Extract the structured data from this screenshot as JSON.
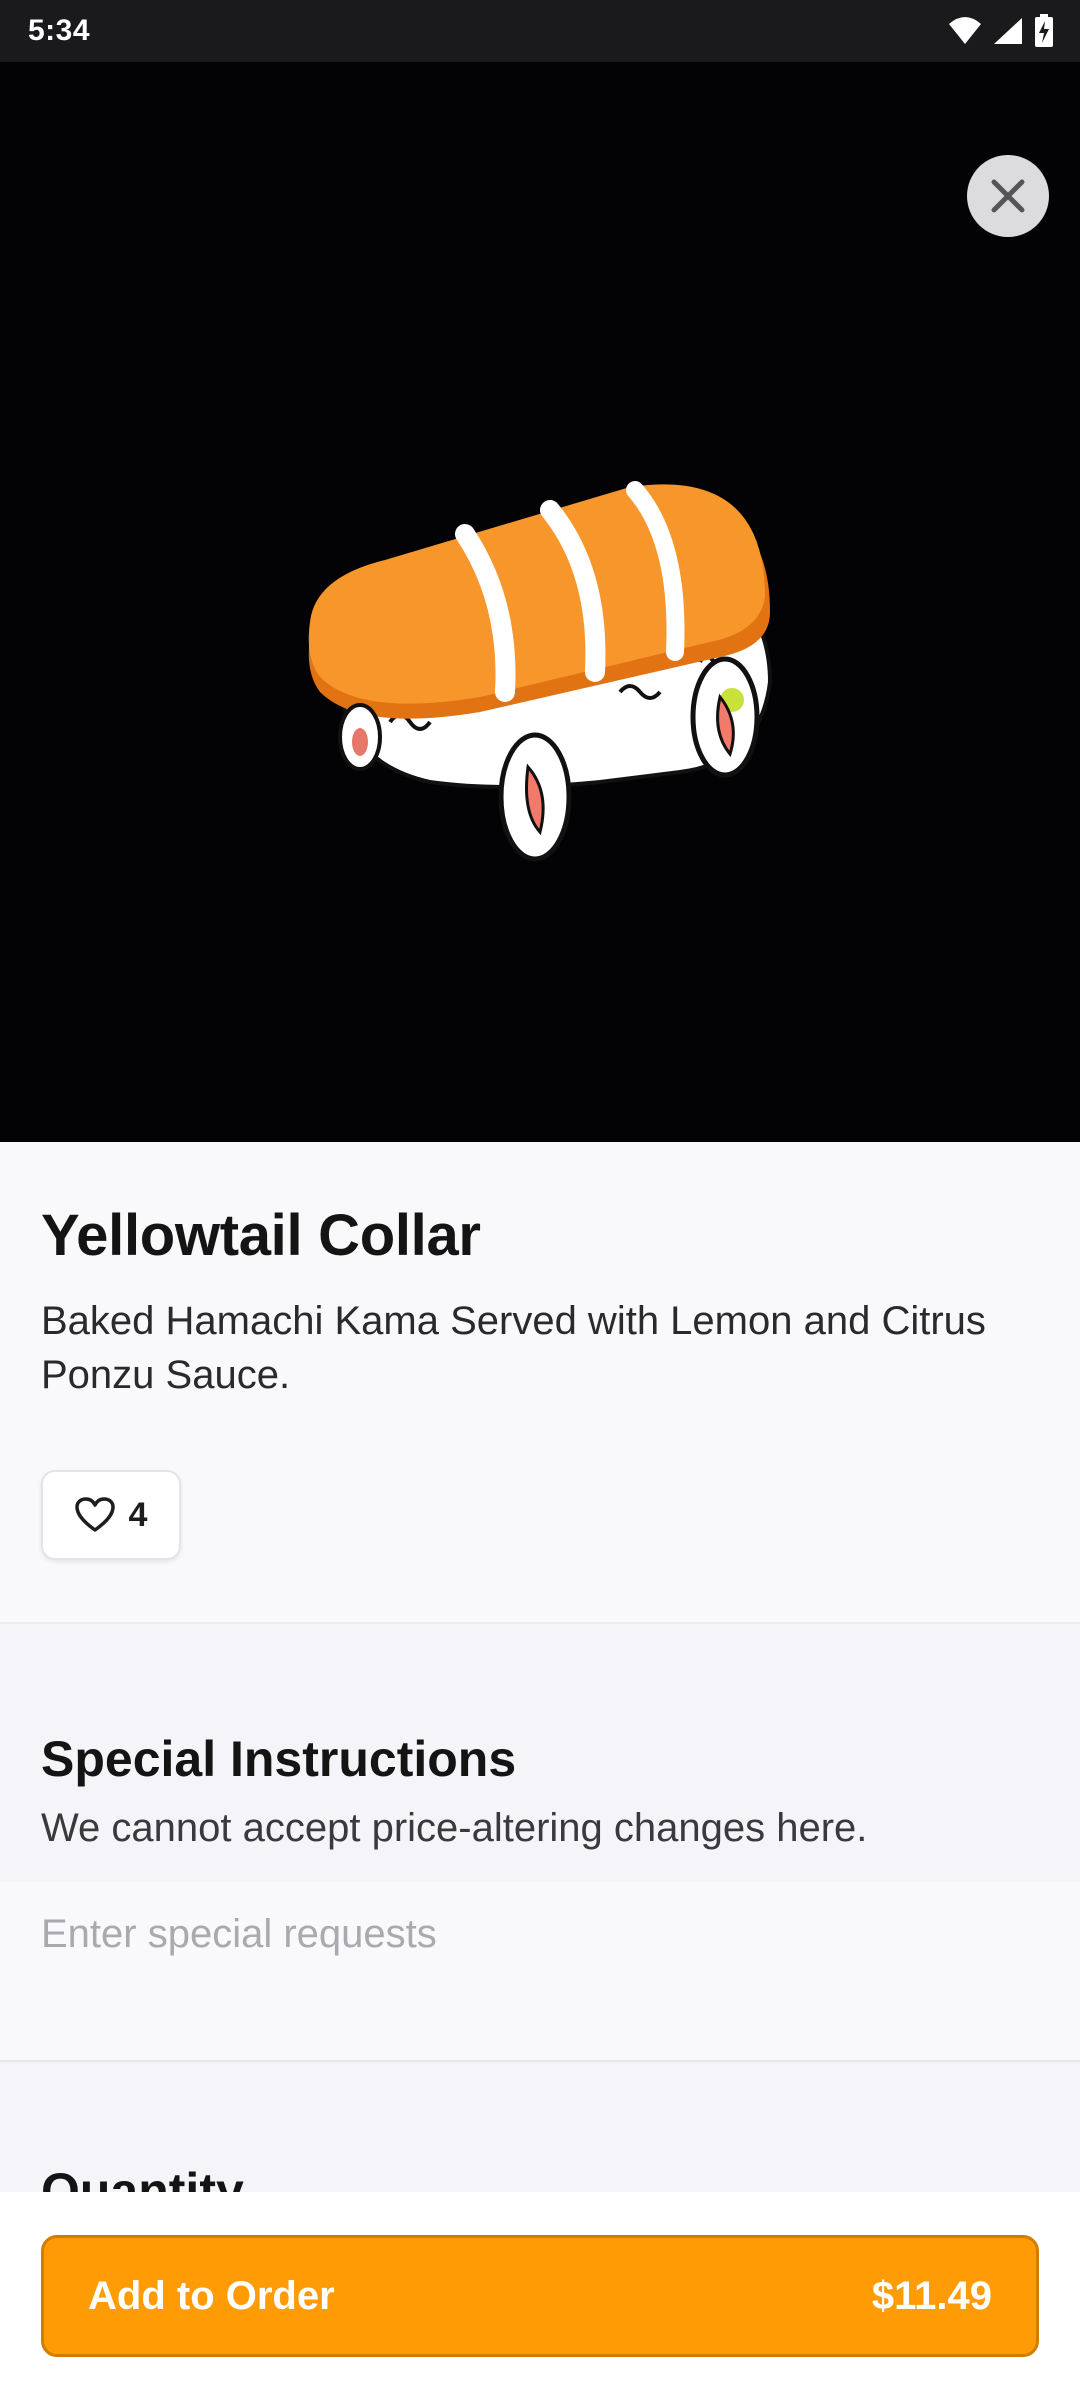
{
  "status_bar": {
    "time": "5:34",
    "icons": [
      "wifi-icon",
      "signal-icon",
      "battery-charging-icon"
    ]
  },
  "hero": {
    "close_icon": "close-icon",
    "background_color": "#030204"
  },
  "item": {
    "title": "Yellowtail Collar",
    "description": "Baked Hamachi Kama Served with Lemon and Citrus Ponzu Sauce.",
    "like_icon": "heart-outline-icon",
    "like_count": "4"
  },
  "special_instructions": {
    "title": "Special Instructions",
    "subtitle": "We cannot accept price-altering changes here.",
    "placeholder": "Enter special requests"
  },
  "quantity": {
    "title": "Quantity"
  },
  "footer": {
    "add_label": "Add to Order",
    "price": "$11.49",
    "accent_color": "#ff9b05"
  }
}
